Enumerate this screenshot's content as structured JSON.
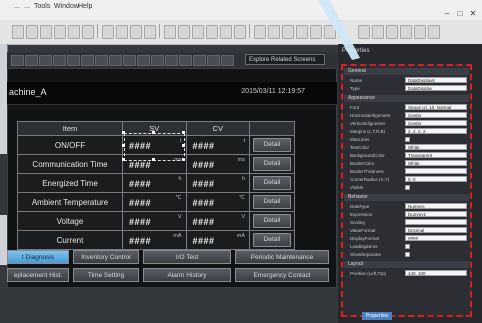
{
  "menubar": {
    "items": [
      "...",
      "...",
      "Tools",
      "Window",
      "Help"
    ]
  },
  "editor": {
    "page_dropdown": "Explore Related Screens"
  },
  "screen": {
    "title": "achine_A",
    "datetime": "2015/03/11 12:19:57",
    "table": {
      "headers": [
        "Item",
        "SV",
        "CV"
      ],
      "rows": [
        {
          "item": "ON/OFF",
          "sv": "####",
          "sv_unit": "t",
          "cv": "####",
          "cv_unit": "t",
          "action": "Detail"
        },
        {
          "item": "Communication Time",
          "sv": "####",
          "sv_unit": "ms",
          "cv": "####",
          "cv_unit": "ms",
          "action": "Detail"
        },
        {
          "item": "Energized Time",
          "sv": "####",
          "sv_unit": "h",
          "cv": "####",
          "cv_unit": "h",
          "action": "Detail"
        },
        {
          "item": "Ambient Temperature",
          "sv": "####",
          "sv_unit": "℃",
          "cv": "####",
          "cv_unit": "℃",
          "action": "Detail"
        },
        {
          "item": "Voltage",
          "sv": "####",
          "sv_unit": "V",
          "cv": "####",
          "cv_unit": "V",
          "action": "Detail"
        },
        {
          "item": "Current",
          "sv": "####",
          "sv_unit": "mA",
          "cv": "####",
          "cv_unit": "mA",
          "action": "Detail"
        }
      ]
    },
    "nav_buttons": [
      [
        "t Diagnosis",
        "Inventory Control",
        "I/O Test",
        "Periodic Maintenance"
      ],
      [
        "eplacement Hist.",
        "Time Setting",
        "Alarm History",
        "Emergency Contact"
      ]
    ]
  },
  "properties": {
    "panel_title": "Properties",
    "sections": {
      "general": "General",
      "appearance": "Appearance",
      "behavior": "Behavior",
      "layout": "Layout"
    },
    "general": [
      {
        "label": "Name",
        "value": "DataDisplay6"
      },
      {
        "label": "Type",
        "value": "DataDisplay"
      }
    ],
    "appearance": [
      {
        "label": "Font",
        "value": "Segoe UI, 10, Normal",
        "kind": "text"
      },
      {
        "label": "HorizontalAlignment",
        "value": "Center",
        "kind": "dropdown"
      },
      {
        "label": "VerticalAlignment",
        "value": "Center",
        "kind": "dropdown"
      },
      {
        "label": "Margins (L,T,R,B)",
        "value": "2, 2, 2, 2",
        "kind": "text"
      },
      {
        "label": "MaxLines",
        "value": "",
        "kind": "check"
      },
      {
        "label": "TextColor",
        "value": "White",
        "kind": "color"
      },
      {
        "label": "BackgroundColor",
        "value": "Transparent",
        "kind": "color"
      },
      {
        "label": "BorderColor",
        "value": "White",
        "kind": "color"
      },
      {
        "label": "BorderThickness",
        "value": "",
        "kind": "text"
      },
      {
        "label": "CornerRadius (X,Y)",
        "value": "0, 0",
        "kind": "text"
      },
      {
        "label": "Visible",
        "value": "",
        "kind": "check"
      }
    ],
    "behavior": [
      {
        "label": "DataType",
        "value": "Numeric",
        "kind": "dropdown"
      },
      {
        "label": "Expression",
        "value": "Dummy1",
        "kind": "text"
      },
      {
        "label": "Scaling",
        "value": "",
        "kind": "text"
      },
      {
        "label": "ValueFormat",
        "value": "Decimal",
        "kind": "dropdown"
      },
      {
        "label": "DisplayFormat",
        "value": "####",
        "kind": "text"
      },
      {
        "label": "LeadingZeros",
        "value": "",
        "kind": "check"
      },
      {
        "label": "ShowSeparator",
        "value": "",
        "kind": "check"
      }
    ],
    "layout": [
      {
        "label": "Position (Left,Top)",
        "value": "140, 100",
        "kind": "text"
      }
    ],
    "bottom_tab": "Properties"
  }
}
